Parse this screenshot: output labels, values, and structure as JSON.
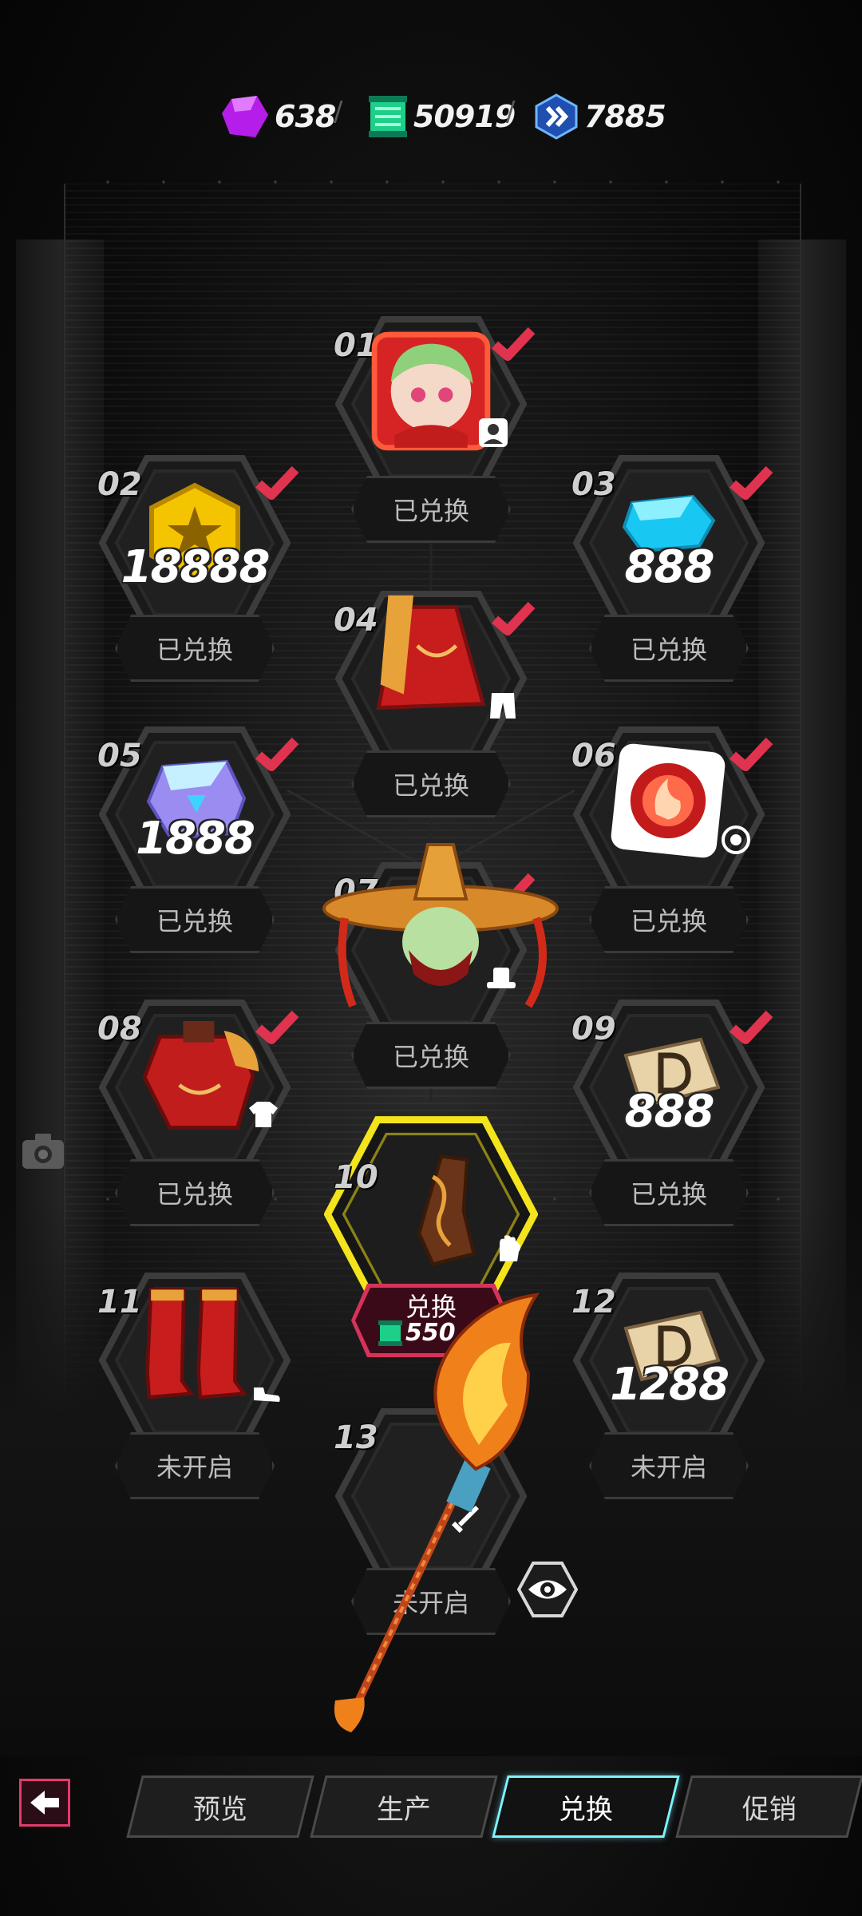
{
  "currencies": [
    {
      "icon": "purple-crystal-icon",
      "value": "638"
    },
    {
      "icon": "green-scroll-icon",
      "value": "50919"
    },
    {
      "icon": "blue-arrow-badge-icon",
      "value": "7885"
    }
  ],
  "currency_separator": "/",
  "slots": [
    {
      "number": "01",
      "button": "已兑换",
      "state": "redeemed",
      "item": "character-avatar",
      "type_icon": "avatar-type-icon"
    },
    {
      "number": "02",
      "button": "已兑换",
      "state": "redeemed",
      "item": "gold-coin",
      "amount": "18888"
    },
    {
      "number": "03",
      "button": "已兑换",
      "state": "redeemed",
      "item": "blue-diamond",
      "amount": "888"
    },
    {
      "number": "04",
      "button": "已兑换",
      "state": "redeemed",
      "item": "red-skirt",
      "type_icon": "pants-type-icon"
    },
    {
      "number": "05",
      "button": "已兑换",
      "state": "redeemed",
      "item": "crystal-ticket",
      "amount": "1888"
    },
    {
      "number": "06",
      "button": "已兑换",
      "state": "redeemed",
      "item": "fire-emblem",
      "type_icon": "target-type-icon"
    },
    {
      "number": "07",
      "button": "已兑换",
      "state": "redeemed",
      "item": "straw-hat",
      "type_icon": "hat-type-icon"
    },
    {
      "number": "08",
      "button": "已兑换",
      "state": "redeemed",
      "item": "red-top",
      "type_icon": "shirt-type-icon"
    },
    {
      "number": "09",
      "button": "已兑换",
      "state": "redeemed",
      "item": "d-ticket",
      "amount": "888"
    },
    {
      "number": "10",
      "button": "兑换",
      "state": "available",
      "item": "brown-glove",
      "type_icon": "glove-type-icon",
      "cost": "550"
    },
    {
      "number": "11",
      "button": "未开启",
      "state": "locked",
      "item": "red-boots",
      "type_icon": "shoe-type-icon"
    },
    {
      "number": "12",
      "button": "未开启",
      "state": "locked",
      "item": "d-ticket",
      "amount": "1288"
    },
    {
      "number": "13",
      "button": "未开启",
      "state": "locked",
      "item": "flame-spear",
      "type_icon": "sword-type-icon"
    }
  ],
  "tabs": [
    {
      "label": "预览",
      "active": false
    },
    {
      "label": "生产",
      "active": false
    },
    {
      "label": "兑换",
      "active": true
    },
    {
      "label": "促销",
      "active": false
    }
  ],
  "colors": {
    "accent_cyan": "#7ef3ff",
    "accent_pink": "#e33b6c",
    "check_red": "#e0334f",
    "highlight_yellow": "#f3e41c"
  }
}
